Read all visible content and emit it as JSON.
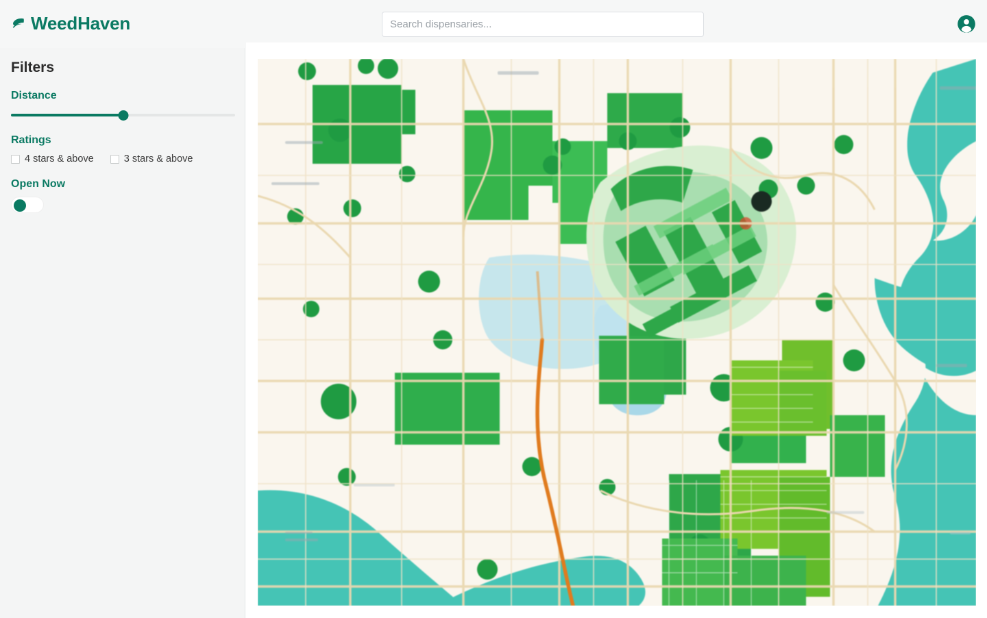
{
  "header": {
    "brand_name": "WeedHaven",
    "brand_icon": "leaf-icon",
    "search_placeholder": "Search dispensaries...",
    "search_value": "",
    "account_icon": "account-circle-icon"
  },
  "sidebar": {
    "title": "Filters",
    "distance": {
      "label": "Distance",
      "value_percent": 50
    },
    "ratings": {
      "label": "Ratings",
      "options": [
        {
          "label": "4 stars & above",
          "checked": false
        },
        {
          "label": "3 stars & above",
          "checked": false
        }
      ]
    },
    "open_now": {
      "label": "Open Now",
      "enabled": false
    }
  },
  "map": {
    "name": "dispensary-map",
    "colors": {
      "land": "#faf6ee",
      "water": "#45c4b5",
      "park_dark": "#20a24a",
      "park_mid": "#3fbe55",
      "park_light": "#7bc62e",
      "road": "#e8d6ad",
      "highway": "#e07b1e"
    }
  },
  "theme": {
    "accent": "#0b7a63",
    "header_bg": "#f6f7f7",
    "sidebar_bg": "#f4f5f5"
  }
}
